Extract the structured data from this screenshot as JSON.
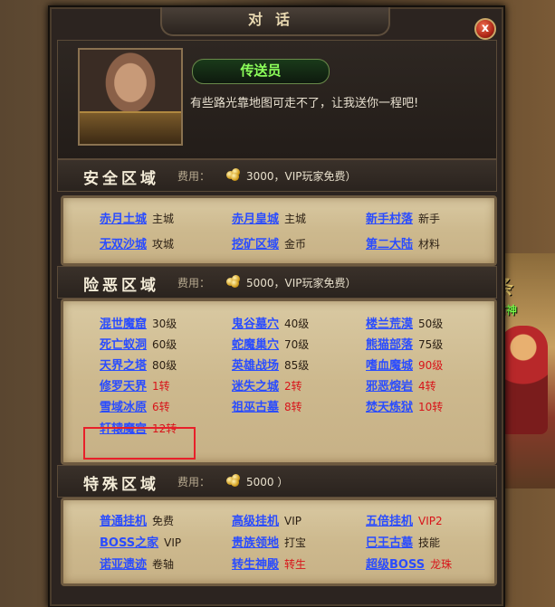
{
  "dialog": {
    "title": "对话",
    "close_label": "x"
  },
  "npc": {
    "name": "传送员",
    "greeting": "有些路光靠地图可走不了，让我送你一程吧!",
    "portrait": "npc-portrait"
  },
  "background": {
    "title_fragment": "条",
    "subtitle_fragment": "财神"
  },
  "sections": [
    {
      "name": "安全区域",
      "fee_label": "费用：",
      "fee_text": "3000，VIP玩家免费）",
      "rows": [
        [
          {
            "label": "赤月土城",
            "suffix": "主城"
          },
          {
            "label": "赤月皇城",
            "suffix": "主城"
          },
          {
            "label": "新手村落",
            "suffix": "新手"
          }
        ],
        [
          {
            "label": "无双沙城",
            "suffix": "攻城"
          },
          {
            "label": "挖矿区域",
            "suffix": "金币"
          },
          {
            "label": "第二大陆",
            "suffix": "材料"
          }
        ]
      ]
    },
    {
      "name": "险恶区域",
      "fee_label": "费用：",
      "fee_text": "5000，VIP玩家免费）",
      "rows": [
        [
          {
            "label": "混世魔窟",
            "suffix": "30级"
          },
          {
            "label": "鬼谷墓穴",
            "suffix": "40级"
          },
          {
            "label": "楼兰荒漠",
            "suffix": "50级"
          }
        ],
        [
          {
            "label": "死亡蚁洞",
            "suffix": "60级"
          },
          {
            "label": "蛇魔巢穴",
            "suffix": "70级"
          },
          {
            "label": "熊猫部落",
            "suffix": "75级"
          }
        ],
        [
          {
            "label": "天界之塔",
            "suffix": "80级"
          },
          {
            "label": "英雄战场",
            "suffix": "85级"
          },
          {
            "label": "嗜血魔城",
            "suffix": "90级",
            "red": true
          }
        ],
        [
          {
            "label": "修罗天界",
            "suffix": "1转",
            "red": true
          },
          {
            "label": "迷失之城",
            "suffix": "2转",
            "red": true
          },
          {
            "label": "邪恶熔岩",
            "suffix": "4转",
            "red": true
          }
        ],
        [
          {
            "label": "雪域冰原",
            "suffix": "6转",
            "red": true
          },
          {
            "label": "祖巫古墓",
            "suffix": "8转",
            "red": true
          },
          {
            "label": "焚天炼狱",
            "suffix": "10转",
            "red": true
          }
        ],
        [
          {
            "label": "轩辕魔宫",
            "suffix": "12转",
            "red": true
          }
        ]
      ]
    },
    {
      "name": "特殊区域",
      "fee_label": "费用：",
      "fee_text": "5000 ）",
      "rows": [
        [
          {
            "label": "普通挂机",
            "suffix": "免费"
          },
          {
            "label": "高级挂机",
            "suffix": "VIP"
          },
          {
            "label": "五倍挂机",
            "suffix": "VIP2",
            "red": true
          }
        ],
        [
          {
            "label": "BOSS之家",
            "suffix": "VIP"
          },
          {
            "label": "贵族领地",
            "suffix": "打宝"
          },
          {
            "label": "巳王古墓",
            "suffix": "技能"
          }
        ],
        [
          {
            "label": "诺亚遗迹",
            "suffix": "卷轴"
          },
          {
            "label": "转生神殿",
            "suffix": "转生",
            "red": true
          },
          {
            "label": "超级BOSS",
            "suffix": "龙珠",
            "red": true
          }
        ]
      ]
    }
  ],
  "colors": {
    "link": "#2a4cff",
    "highlight": "#e8202a",
    "red_text": "#d8141a",
    "npc_name": "#8cff5a"
  }
}
